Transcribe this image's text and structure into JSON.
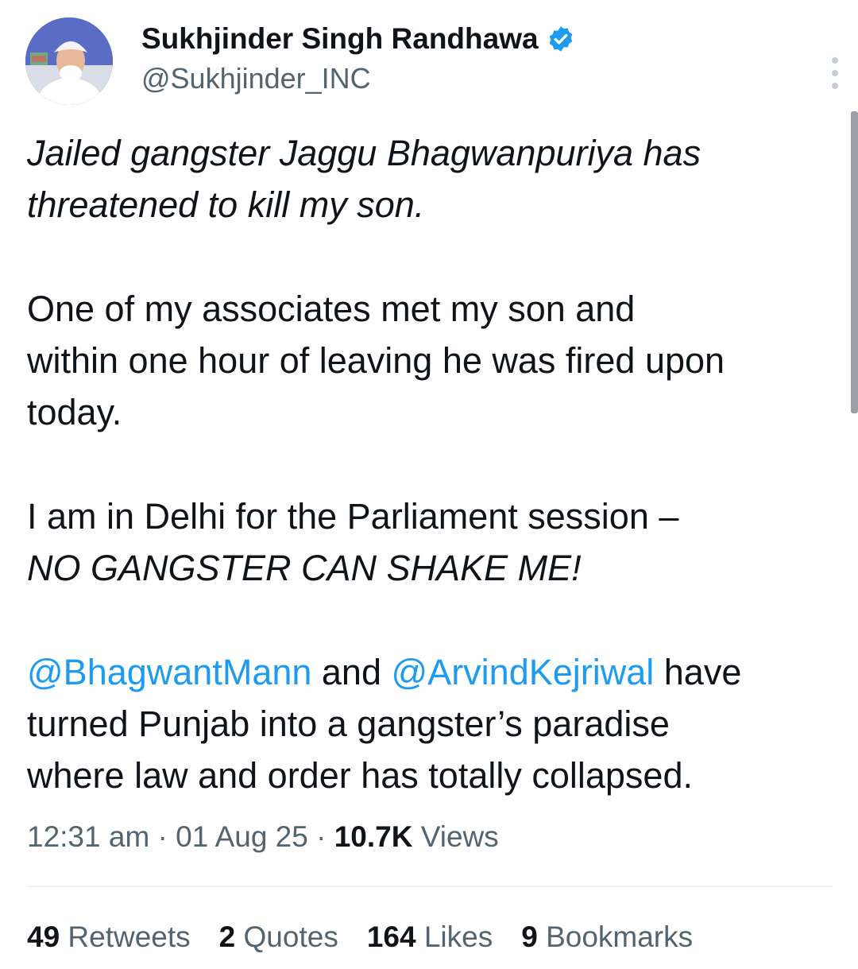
{
  "author": {
    "name": "Sukhjinder Singh Randhawa",
    "handle": "@Sukhjinder_INC",
    "verified_color": "#1d9bf0"
  },
  "icons": {
    "verified": "verified-badge-icon",
    "more": "more-vertical-icon",
    "avatar": "profile-photo"
  },
  "tweet": {
    "para1_line1": "Jailed gangster Jaggu Bhagwanpuriya has",
    "para1_line2": "threatened to kill my son.",
    "para2_line1": "One of my associates met my son and",
    "para2_line2": "within one hour of leaving he was fired upon",
    "para2_line3": "today.",
    "para3_line1": "I am in Delhi for the Parliament session –",
    "para3_line2": "NO GANGSTER CAN SHAKE ME!",
    "mention1": "@BhagwantMann",
    "and_text": " and ",
    "mention2": "@ArvindKejriwal",
    "have_text": " have",
    "para4_line2": "turned Punjab into a gangster’s paradise",
    "para4_line3": "where law and order has totally collapsed."
  },
  "meta": {
    "time": "12:31 am",
    "sep1": " · ",
    "date": "01 Aug 25",
    "sep2": " · ",
    "views_count": "10.7K",
    "views_label": " Views"
  },
  "stats": [
    {
      "count": "49",
      "label": " Retweets"
    },
    {
      "count": "2",
      "label": " Quotes"
    },
    {
      "count": "164",
      "label": " Likes"
    },
    {
      "count": "9",
      "label": " Bookmarks"
    }
  ],
  "colors": {
    "link": "#1d9bf0",
    "secondary_text": "#536471",
    "primary_text": "#0f1419"
  }
}
